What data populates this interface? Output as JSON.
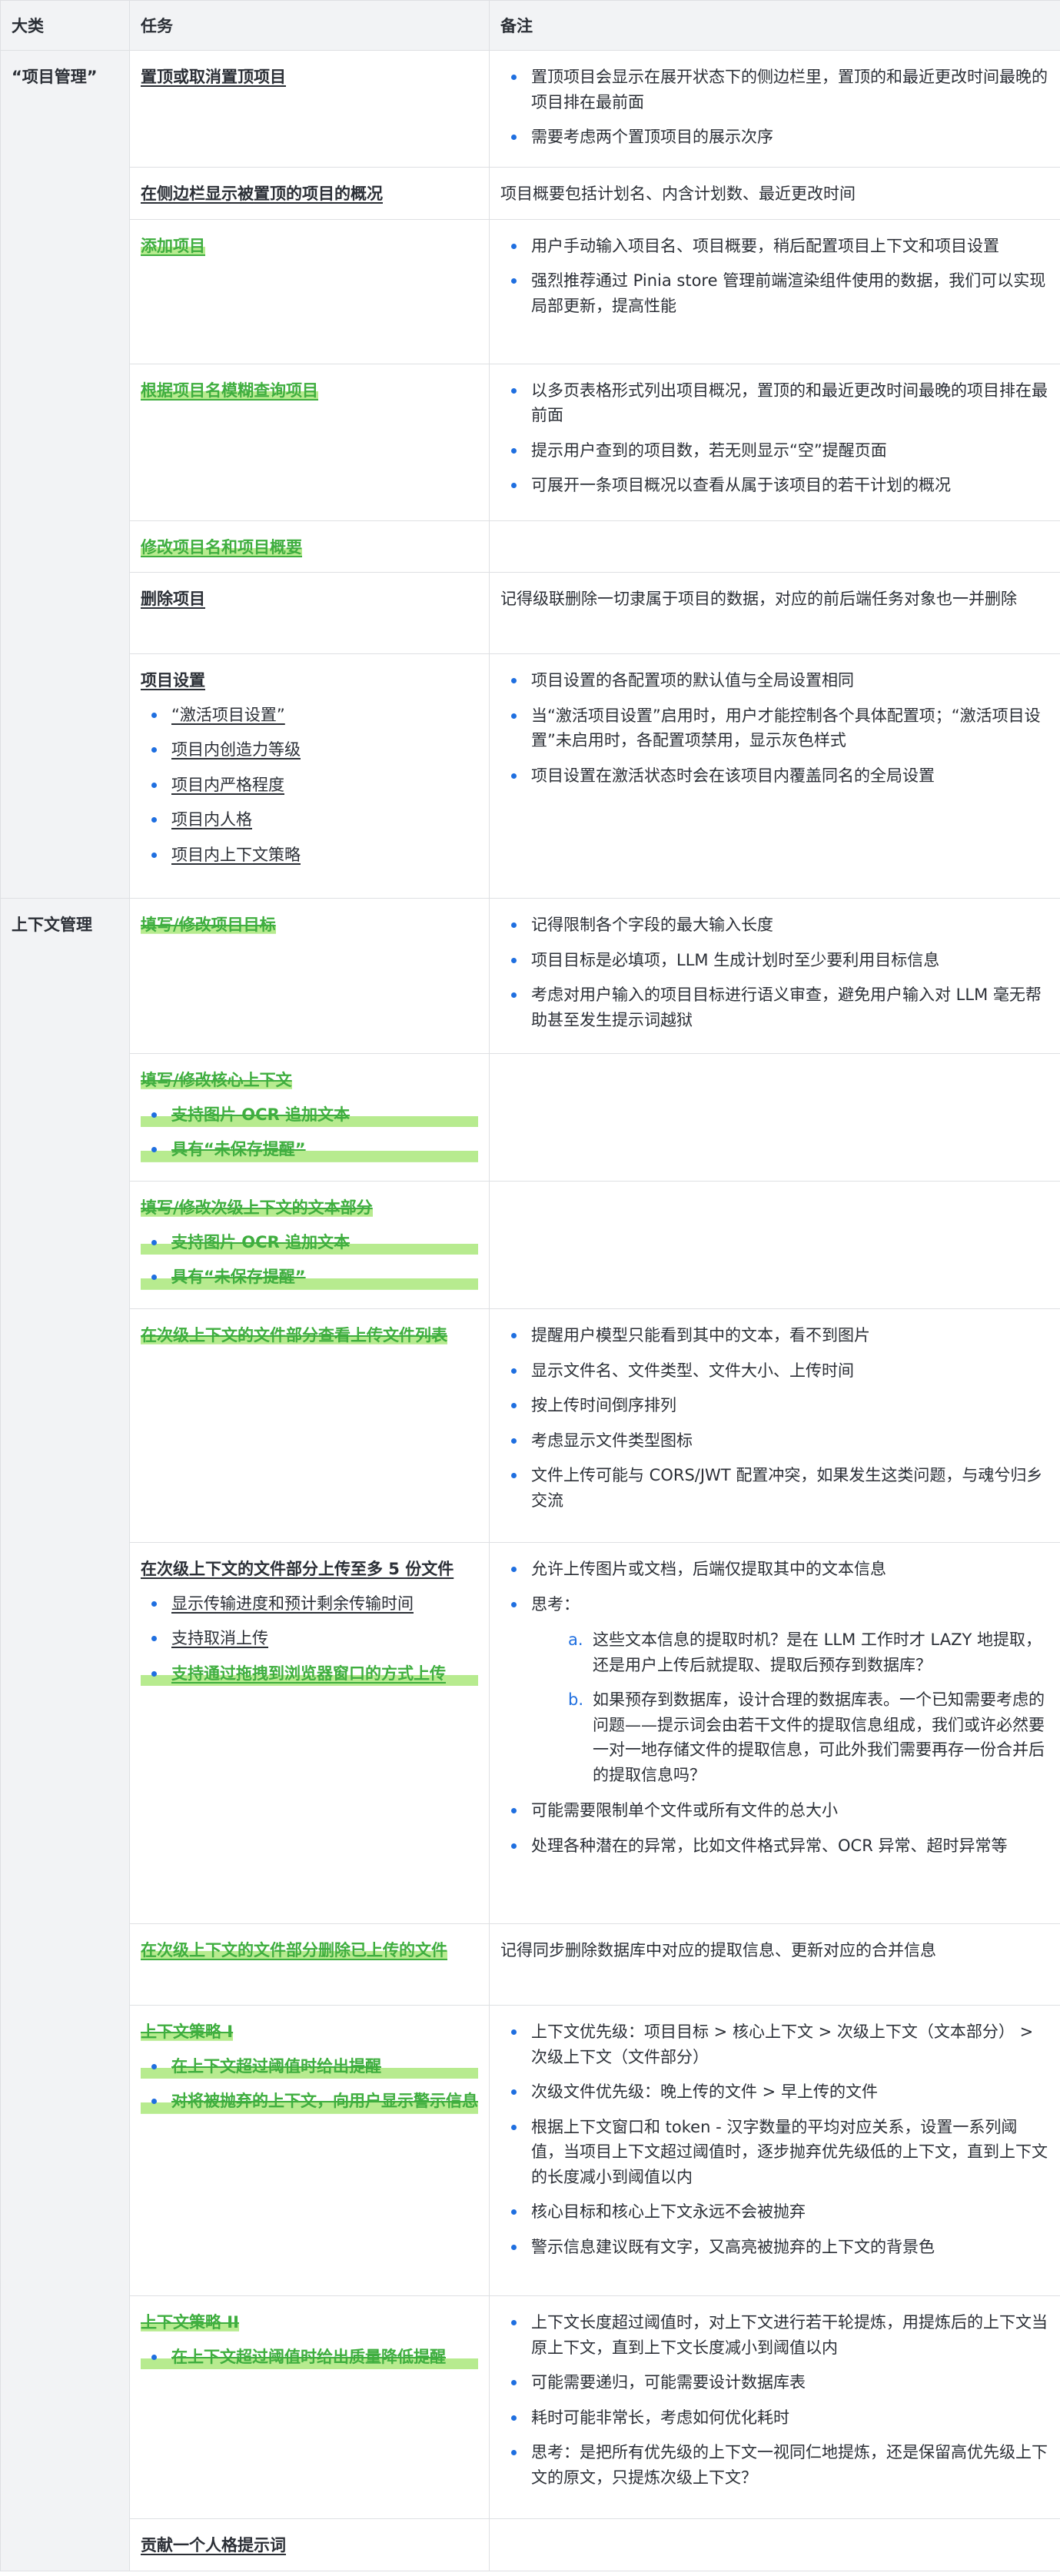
{
  "headers": [
    "大类",
    "任务",
    "备注"
  ],
  "categories": {
    "project": "“项目管理”",
    "context": "上下文管理"
  },
  "rows": {
    "pin": {
      "task": "置顶或取消置顶项目",
      "notes": [
        "置顶项目会显示在展开状态下的侧边栏里，置顶的和最近更改时间最晚的项目排在最前面",
        "需要考虑两个置顶项目的展示次序"
      ]
    },
    "sidebar": {
      "task": "在侧边栏显示被置顶的项目的概况",
      "note": "项目概要包括计划名、内含计划数、最近更改时间"
    },
    "add": {
      "task": "添加项目",
      "notes": [
        "用户手动输入项目名、项目概要，稍后配置项目上下文和项目设置",
        "强烈推荐通过 Pinia store 管理前端渲染组件使用的数据，我们可以实现局部更新，提高性能"
      ]
    },
    "search": {
      "task": "根据项目名模糊查询项目",
      "notes": [
        "以多页表格形式列出项目概况，置顶的和最近更改时间最晚的项目排在最前面",
        "提示用户查到的项目数，若无则显示“空”提醒页面",
        "可展开一条项目概况以查看从属于该项目的若干计划的概况"
      ]
    },
    "edit": {
      "task": "修改项目名和项目概要"
    },
    "delete": {
      "task": "删除项目",
      "note": "记得级联删除一切隶属于项目的数据，对应的前后端任务对象也一并删除"
    },
    "settings": {
      "task": "项目设置",
      "subs": [
        "“激活项目设置”",
        "项目内创造力等级",
        "项目内严格程度",
        "项目内人格",
        "项目内上下文策略"
      ],
      "notes": [
        "项目设置的各配置项的默认值与全局设置相同",
        "当“激活项目设置”启用时，用户才能控制各个具体配置项；“激活项目设置”未启用时，各配置项禁用，显示灰色样式",
        "项目设置在激活状态时会在该项目内覆盖同名的全局设置"
      ]
    },
    "goal": {
      "task": "填写/修改项目目标",
      "notes": [
        "记得限制各个字段的最大输入长度",
        "项目目标是必填项，LLM 生成计划时至少要利用目标信息",
        "考虑对用户输入的项目目标进行语义审查，避免用户输入对 LLM 毫无帮助甚至发生提示词越狱"
      ]
    },
    "core": {
      "task": "填写/修改核心上下文",
      "subs": [
        "支持图片 OCR 追加文本",
        "具有“未保存提醒”"
      ]
    },
    "secondary_text": {
      "task": "填写/修改次级上下文的文本部分",
      "subs": [
        "支持图片 OCR 追加文本",
        "具有“未保存提醒”"
      ]
    },
    "file_list": {
      "task": "在次级上下文的文件部分查看上传文件列表",
      "notes": [
        "提醒用户模型只能看到其中的文本，看不到图片",
        "显示文件名、文件类型、文件大小、上传时间",
        "按上传时间倒序排列",
        "考虑显示文件类型图标",
        "文件上传可能与 CORS/JWT 配置冲突，如果发生这类问题，与魂兮归乡交流"
      ]
    },
    "upload": {
      "task": "在次级上下文的文件部分上传至多 5 份文件",
      "subs": [
        "显示传输进度和预计剩余传输时间",
        "支持取消上传",
        "支持通过拖拽到浏览器窗口的方式上传"
      ],
      "notes_before": [
        "允许上传图片或文档，后端仅提取其中的文本信息",
        "思考："
      ],
      "think": [
        {
          "num": "a.",
          "text": "这些文本信息的提取时机？是在 LLM 工作时才 LAZY 地提取，还是用户上传后就提取、提取后预存到数据库？"
        },
        {
          "num": "b.",
          "text": "如果预存到数据库，设计合理的数据库表。一个已知需要考虑的问题——提示词会由若干文件的提取信息组成，我们或许必然要一对一地存储文件的提取信息，可此外我们需要再存一份合并后的提取信息吗？"
        }
      ],
      "notes_after": [
        "可能需要限制单个文件或所有文件的总大小",
        "处理各种潜在的异常，比如文件格式异常、OCR 异常、超时异常等"
      ]
    },
    "file_delete": {
      "task": "在次级上下文的文件部分删除已上传的文件",
      "note": "记得同步删除数据库中对应的提取信息、更新对应的合并信息"
    },
    "strategy1": {
      "task": "上下文策略 I",
      "subs": [
        "在上下文超过阈值时给出提醒",
        "对将被抛弃的上下文，向用户显示警示信息"
      ],
      "notes": [
        "上下文优先级：项目目标 > 核心上下文 > 次级上下文（文本部分） > 次级上下文（文件部分）",
        "次级文件优先级：晚上传的文件 > 早上传的文件",
        "根据上下文窗口和 token - 汉字数量的平均对应关系，设置一系列阈值，当项目上下文超过阈值时，逐步抛弃优先级低的上下文，直到上下文的长度减小到阈值以内",
        "核心目标和核心上下文永远不会被抛弃",
        "警示信息建议既有文字，又高亮被抛弃的上下文的背景色"
      ]
    },
    "strategy2": {
      "task": "上下文策略 II",
      "subs": [
        "在上下文超过阈值时给出质量降低提醒"
      ],
      "notes": [
        "上下文长度超过阈值时，对上下文进行若干轮提炼，用提炼后的上下文当原上下文，直到上下文长度减小到阈值以内",
        "可能需要递归，可能需要设计数据库表",
        "耗时可能非常长，考虑如何优化耗时",
        "思考：是把所有优先级的上下文一视同仁地提炼，还是保留高优先级上下文的原文，只提炼次级上下文？"
      ]
    },
    "persona": {
      "task": "贡献一个人格提示词"
    }
  }
}
